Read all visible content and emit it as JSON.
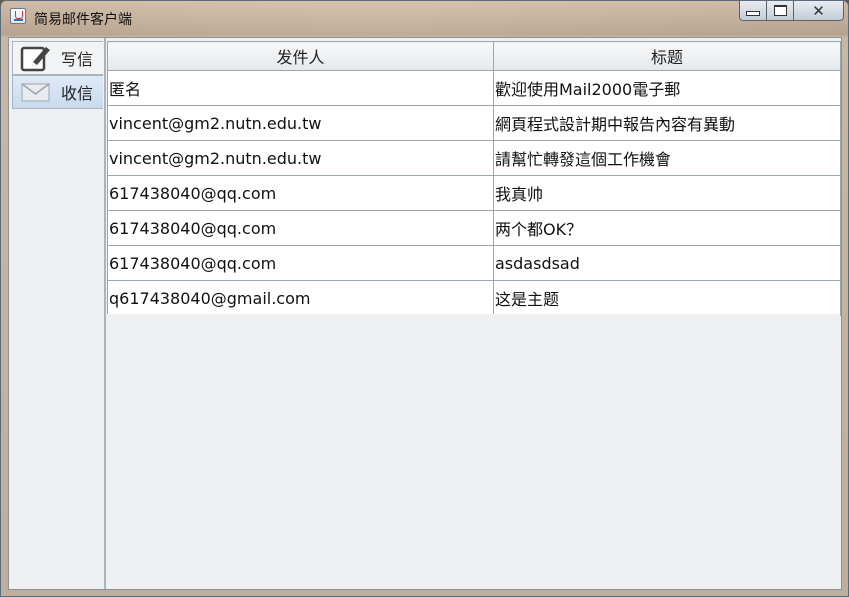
{
  "window": {
    "title": "简易邮件客户端",
    "controls": {
      "minimize": "minimize",
      "maximize": "maximize",
      "close": "✕"
    }
  },
  "sidebar": {
    "tabs": [
      {
        "label": "写信",
        "icon": "compose-icon"
      },
      {
        "label": "收信",
        "icon": "envelope-icon"
      }
    ],
    "selected": "收信"
  },
  "table": {
    "columns": [
      "发件人",
      "标题"
    ],
    "rows": [
      [
        "匿名",
        "歡迎使用Mail2000電子郵"
      ],
      [
        "vincent@gm2.nutn.edu.tw",
        "網頁程式設計期中報告內容有異動"
      ],
      [
        "vincent@gm2.nutn.edu.tw",
        "請幫忙轉發這個工作機會"
      ],
      [
        "617438040@qq.com",
        "我真帅"
      ],
      [
        "617438040@qq.com",
        "两个都OK？"
      ],
      [
        "617438040@qq.com",
        "asdasdsad"
      ],
      [
        "q617438040@gmail.com",
        "这是主题"
      ]
    ]
  }
}
